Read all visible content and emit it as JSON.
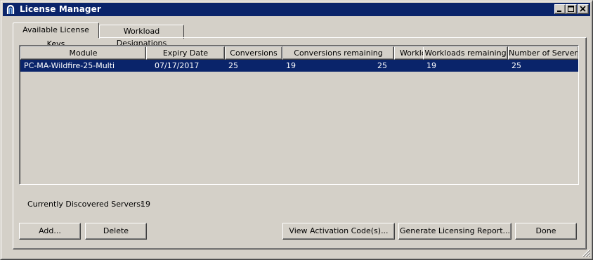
{
  "window": {
    "title": "License Manager",
    "icon": "license-manager-app-icon",
    "controls": [
      "minimize-icon",
      "maximize-icon",
      "close-icon"
    ]
  },
  "tabs": [
    {
      "label": "Available License Keys",
      "active": true
    },
    {
      "label": "Workload Designations",
      "active": false
    }
  ],
  "table": {
    "columns": [
      "Module",
      "Expiry Date",
      "Conversions",
      "Conversions remaining",
      "Workloads",
      "Workloads remaining",
      "Number of Servers"
    ],
    "rows": [
      [
        "PC-MA-Wildfire-25-Multi",
        "07/17/2017",
        "25",
        "19",
        "25",
        "19",
        "25"
      ]
    ],
    "selected_row": 0
  },
  "status": {
    "label": "Currently Discovered Servers:",
    "value": "19"
  },
  "buttons": {
    "add": "Add...",
    "delete": "Delete",
    "view_codes": "View Activation Code(s)...",
    "report": "Generate Licensing Report...",
    "done": "Done"
  },
  "colors": {
    "titlebar": "#0a246a",
    "face": "#d4d0c8",
    "selection": "#0a246a"
  }
}
